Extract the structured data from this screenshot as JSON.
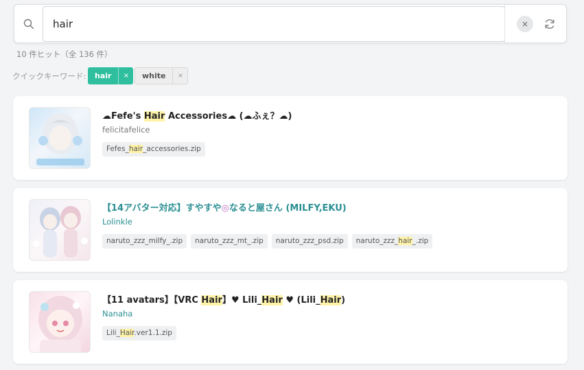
{
  "search": {
    "query": "hair"
  },
  "hit_count": "10 件ヒット（全 136 件）",
  "quick_keywords": {
    "label": "クイックキーワード:",
    "tags": [
      {
        "label": "hair",
        "active": true,
        "remove": "×"
      },
      {
        "label": "white",
        "active": false,
        "remove": "×"
      }
    ]
  },
  "clear_glyph": "×",
  "results": [
    {
      "title_parts": [
        "☁Fefe's ",
        "Hair",
        " Accessories☁ (☁ふぇ？☁)"
      ],
      "author": "felicitafelice",
      "files": [
        {
          "parts": [
            "Fefes_",
            "hair",
            "_accessories.zip"
          ]
        }
      ]
    },
    {
      "title_parts": [
        "【14アバター対応】すやすや",
        "◎",
        "なると屋さん (MILFY,EKU)"
      ],
      "author": "Lolinkle",
      "files": [
        {
          "parts": [
            "naruto_zzz_milfy_.zip"
          ]
        },
        {
          "parts": [
            "naruto_zzz_mt_.zip"
          ]
        },
        {
          "parts": [
            "naruto_zzz_psd.zip"
          ]
        },
        {
          "parts": [
            "naruto_zzz_",
            "hair",
            "_.zip"
          ]
        }
      ]
    },
    {
      "title_parts": [
        "【11 avatars】【VRC ",
        "Hair",
        "】♥ Lili_",
        "Hair",
        " ♥ (Lili_",
        "Hair",
        ")"
      ],
      "author": "Nanaha",
      "files": [
        {
          "parts": [
            "Lili_",
            "Hair",
            ".ver1.1.zip"
          ]
        }
      ]
    }
  ]
}
